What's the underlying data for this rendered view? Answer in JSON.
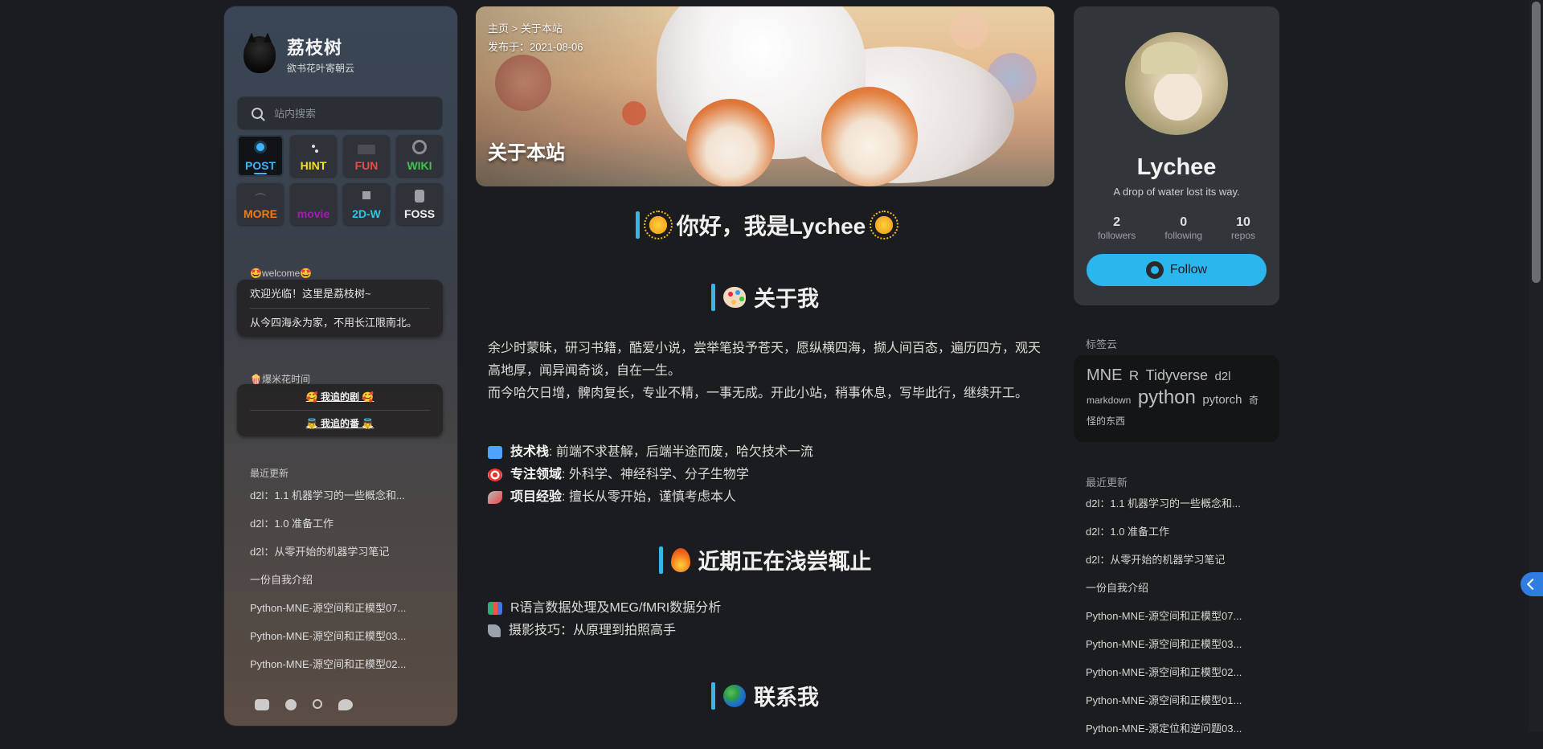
{
  "left": {
    "brand_name": "荔枝树",
    "brand_sub": "欲书花叶寄朝云",
    "search_placeholder": "站内搜索",
    "tiles": [
      {
        "label": "POST",
        "color": "#41b4ff",
        "icon": "sun-icon"
      },
      {
        "label": "HINT",
        "color": "#f6e21b",
        "icon": "dots-icon"
      },
      {
        "label": "FUN",
        "color": "#e2504c",
        "icon": "box-icon"
      },
      {
        "label": "WIKI",
        "color": "#3fc64c",
        "icon": "ring-icon"
      },
      {
        "label": "MORE",
        "color": "#f07a14",
        "icon": "arc-icon"
      },
      {
        "label": "movie",
        "color": "#a21caf",
        "icon": "bar-icon"
      },
      {
        "label": "2D-W",
        "color": "#2ac6e8",
        "icon": "square-icon"
      },
      {
        "label": "FOSS",
        "color": "#f2f2f2",
        "icon": "can-icon"
      }
    ],
    "welcome_title": "🤩welcome🤩",
    "welcome_lines": [
      "欢迎光临！这里是荔枝树~",
      "从今四海永为家，不用长江限南北。"
    ],
    "popcorn_title": "🍿爆米花时间",
    "popcorn_lines": [
      "🥰 我追的剧 🥰",
      "👼 我追的番 👼"
    ],
    "recent_title": "最近更新",
    "recent": [
      "d2l：1.1 机器学习的一些概念和...",
      "d2l：1.0 准备工作",
      "d2l：从零开始的机器学习笔记",
      "一份自我介绍",
      "Python-MNE-源空间和正模型07...",
      "Python-MNE-源空间和正模型03...",
      "Python-MNE-源空间和正模型02..."
    ]
  },
  "hero": {
    "crumb_home": "主页",
    "crumb_sep": ">",
    "crumb_current": "关于本站",
    "published": "发布于：2021-08-06",
    "title": "关于本站"
  },
  "article": {
    "h1": "你好，我是Lychee",
    "h2": "关于我",
    "para1": "余少时蒙昧，研习书籍，酷爱小说，尝举笔投予苍天，愿纵横四海，撷人间百态，遍历四方，观天高地厚，闻异闻奇谈，自在一生。",
    "para2": "而今哈欠日增，髀肉复长，专业不精，一事无成。开此小站，稍事休息，写毕此行，继续开工。",
    "list": [
      {
        "label": "技术栈",
        "text": ": 前端不求甚解，后端半途而废，哈欠技术一流",
        "icon": "laptop-icon"
      },
      {
        "label": "专注领域",
        "text": ": 外科学、神经科学、分子生物学",
        "icon": "target-icon"
      },
      {
        "label": "项目经验",
        "text": ": 擅长从零开始，谨慎考虑本人",
        "icon": "rocket-icon"
      }
    ],
    "h3": "近期正在浅尝辄止",
    "list2": [
      {
        "text": "R语言数据处理及MEG/fMRI数据分析",
        "icon": "books-icon"
      },
      {
        "text": "摄影技巧：从原理到拍照高手",
        "icon": "wrench-icon"
      }
    ],
    "h4": "联系我"
  },
  "profile": {
    "name": "Lychee",
    "bio": "A drop of water lost its way.",
    "followers": "2",
    "followers_label": "followers",
    "following": "0",
    "following_label": "following",
    "repos": "10",
    "repos_label": "repos",
    "follow_label": "Follow",
    "accent": "#2bb6ee"
  },
  "tagcloud": {
    "title": "标签云",
    "tags": [
      {
        "text": "MNE",
        "size": 20
      },
      {
        "text": "R",
        "size": 17
      },
      {
        "text": "Tidyverse",
        "size": 18
      },
      {
        "text": "d2l",
        "size": 15
      },
      {
        "text": "markdown",
        "size": 12
      },
      {
        "text": "python",
        "size": 24
      },
      {
        "text": "pytorch",
        "size": 15
      },
      {
        "text": "奇怪的东西",
        "size": 12
      }
    ]
  },
  "right_recent": {
    "title": "最近更新",
    "items": [
      "d2l：1.1 机器学习的一些概念和...",
      "d2l：1.0 准备工作",
      "d2l：从零开始的机器学习笔记",
      "一份自我介绍",
      "Python-MNE-源空间和正模型07...",
      "Python-MNE-源空间和正模型03...",
      "Python-MNE-源空间和正模型02...",
      "Python-MNE-源空间和正模型01...",
      "Python-MNE-源定位和逆问题03..."
    ]
  }
}
